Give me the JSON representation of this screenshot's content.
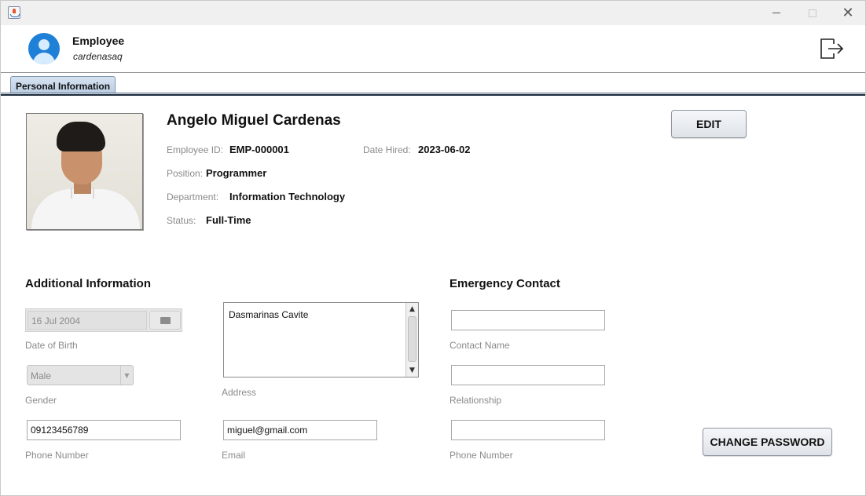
{
  "window": {
    "controls": {
      "minimize": "—",
      "maximize": "☐",
      "close": "✕"
    }
  },
  "header": {
    "role": "Employee",
    "username": "cardenasaq"
  },
  "tabs": [
    {
      "label": "Personal Information",
      "selected": true
    }
  ],
  "profile": {
    "name": "Angelo Miguel Cardenas",
    "employee_id_label": "Employee ID:",
    "employee_id": "EMP-000001",
    "date_hired_label": "Date Hired:",
    "date_hired": "2023-06-02",
    "position_label": "Position:",
    "position": "Programmer",
    "department_label": "Department:",
    "department": "Information Technology",
    "status_label": "Status:",
    "status": "Full-Time"
  },
  "buttons": {
    "edit": "EDIT",
    "change_password": "CHANGE PASSWORD"
  },
  "additional_info": {
    "title": "Additional Information",
    "date_of_birth": {
      "value": "16 Jul 2004",
      "label": "Date of Birth"
    },
    "gender": {
      "value": "Male",
      "label": "Gender"
    },
    "phone": {
      "value": "09123456789",
      "label": "Phone Number"
    },
    "address": {
      "value": "Dasmarinas Cavite",
      "label": "Address"
    },
    "email": {
      "value": "miguel@gmail.com",
      "label": "Email"
    }
  },
  "emergency_contact": {
    "title": "Emergency Contact",
    "contact_name": {
      "value": "",
      "label": "Contact Name"
    },
    "relationship": {
      "value": "",
      "label": "Relationship"
    },
    "phone": {
      "value": "",
      "label": "Phone Number"
    }
  },
  "icons": {
    "app": "java-icon",
    "avatar": "user-avatar-icon",
    "logout": "logout-icon",
    "calendar": "calendar-icon"
  },
  "colors": {
    "avatar": "#1e80d6",
    "tab": "#c7d6e8",
    "label_gray": "#8a8a8a"
  }
}
